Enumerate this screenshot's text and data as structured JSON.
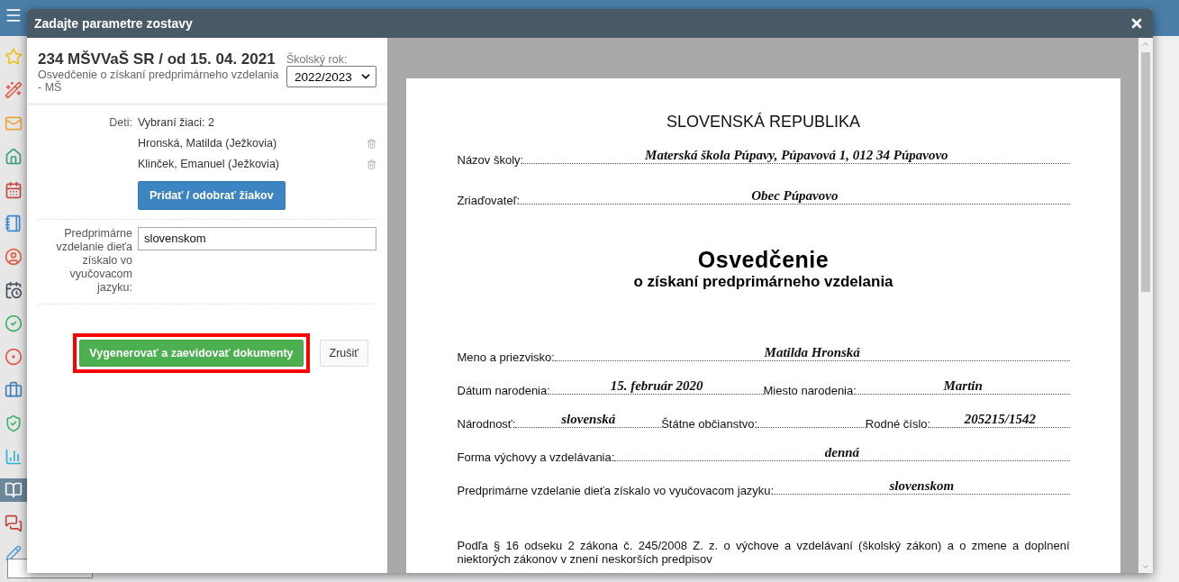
{
  "sidebar": {
    "items": [
      {
        "selected": false
      },
      {
        "selected": false
      },
      {
        "selected": false
      },
      {
        "selected": false
      },
      {
        "selected": false
      },
      {
        "selected": false
      },
      {
        "selected": false
      },
      {
        "selected": false
      },
      {
        "selected": false
      },
      {
        "selected": false
      },
      {
        "selected": false
      },
      {
        "selected": false
      },
      {
        "selected": false
      },
      {
        "selected": true
      },
      {
        "selected": false
      }
    ]
  },
  "dialog": {
    "title": "Zadajte parametre zostavy",
    "report": {
      "title": "234 MŠVVaŠ SR / od 15. 04. 2021",
      "subtitle": "Osvedčenie o získaní predprimárneho vzdelania - MŠ"
    },
    "school_year": {
      "label": "Školský rok:",
      "value": "2022/2023"
    },
    "children": {
      "label": "Deti:",
      "summary": "Vybraní žiaci: 2",
      "pupils": [
        "Hronská, Matilda (Ježkovia)",
        "Klinček, Emanuel (Ježkovia)"
      ],
      "button": "Pridať / odobrať žiakov"
    },
    "language": {
      "label": "Predprimárne vzdelanie dieťa získalo vo vyučovacom jazyku:",
      "value": "slovenskom"
    },
    "buttons": [
      {
        "label": "Vygenerovať a zaevidovať dokumenty",
        "kind": "primary",
        "highlighted": true
      },
      {
        "label": "Zrušiť",
        "kind": "default",
        "highlighted": false
      }
    ]
  },
  "document": {
    "country": "SLOVENSKÁ REPUBLIKA",
    "header_rows": [
      [
        {
          "label": "Názov školy:",
          "value": "Materská škola Púpavy, Púpavová 1, 012 34 Púpavovo"
        }
      ],
      [
        {
          "label": "Zriaďovateľ:",
          "value": "Obec Púpavovo"
        }
      ]
    ],
    "title": "Osvedčenie",
    "subtitle": "o získaní predprimárneho vzdelania",
    "detail_rows": [
      [
        {
          "label": "Meno a priezvisko:",
          "value": "Matilda Hronská"
        }
      ],
      [
        {
          "label": "Dátum narodenia:",
          "value": "15. február 2020"
        },
        {
          "label": "Miesto narodenia:",
          "value": "Martin"
        }
      ],
      [
        {
          "label": "Národnosť:",
          "value": "slovenská"
        },
        {
          "label": "Štátne občianstvo:"
        },
        {
          "label": "Rodné číslo:",
          "value": "205215/1542"
        }
      ],
      [
        {
          "label": "Forma výchovy a vzdelávania:",
          "value": "denná"
        }
      ],
      [
        {
          "label": "Predprimárne vzdelanie dieťa získalo vo vyučovacom jazyku:",
          "value": "slovenskom"
        }
      ]
    ],
    "legal_note": "Podľa § 16 odseku 2 zákona č. 245/2008 Z. z. o výchove a vzdelávaní (školský zákon) a o zmene a doplnení niektorých zákonov v znení neskorších predpisov"
  }
}
